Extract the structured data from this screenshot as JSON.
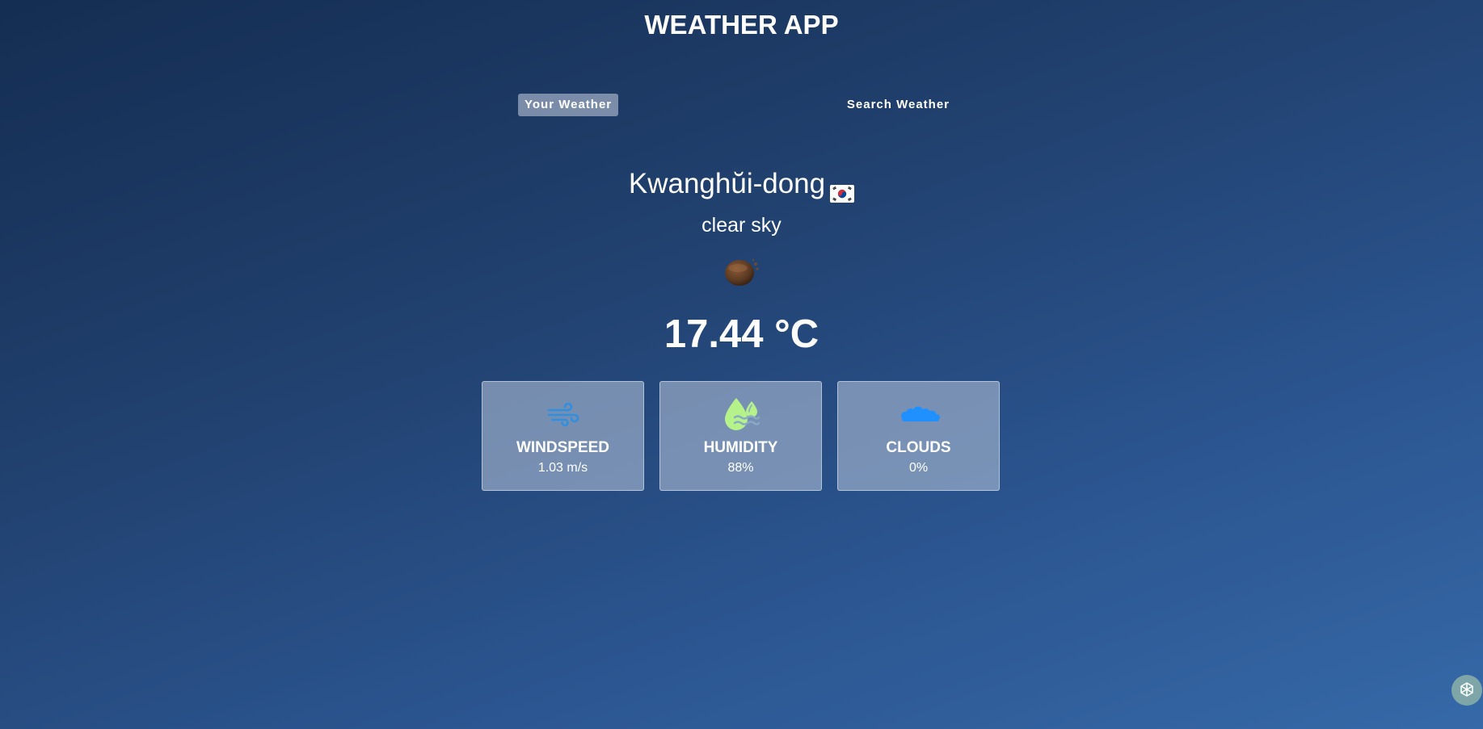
{
  "app": {
    "title": "WEATHER APP"
  },
  "tabs": [
    {
      "label": "Your Weather",
      "active": true
    },
    {
      "label": "Search Weather",
      "active": false
    }
  ],
  "location": {
    "city": "Kwanghŭi-dong",
    "flag_icon": "south-korea-flag-icon"
  },
  "weather": {
    "description": "clear sky",
    "icon": "clear-sky-night-icon",
    "temperature": "17.44 °C"
  },
  "stats": [
    {
      "label": "WINDSPEED",
      "value": "1.03 m/s",
      "icon": "wind-icon",
      "icon_color": "#2f8fe0"
    },
    {
      "label": "HUMIDITY",
      "value": "88%",
      "icon": "humidity-drops-icon",
      "icon_color": "#b6f28a"
    },
    {
      "label": "CLOUDS",
      "value": "0%",
      "icon": "clouds-icon",
      "icon_color": "#1e90ff"
    }
  ],
  "colors": {
    "background_top": "#142d52",
    "background_bottom": "#3669a8",
    "card_bg": "#aab9d2",
    "active_tab_bg": "#c8d2e1"
  },
  "assistant": {
    "icon": "assistant-icon"
  }
}
